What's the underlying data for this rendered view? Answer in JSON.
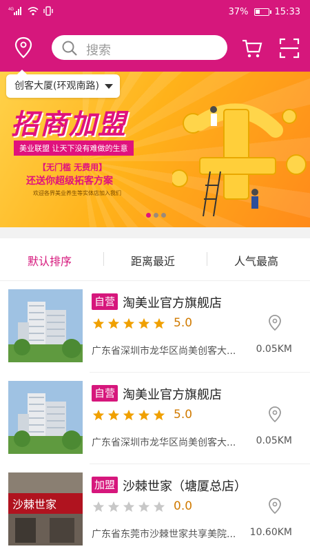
{
  "status_bar": {
    "signal_label": "4G",
    "battery": "37%",
    "battery_level": 0.37,
    "time": "15:33"
  },
  "header": {
    "search_placeholder": "搜索",
    "icons": [
      "location-icon",
      "search-icon",
      "cart-icon",
      "scan-icon"
    ]
  },
  "location_tip": "创客大厦(环观南路)",
  "banner": {
    "title": "招商加盟",
    "tag": "美业联盟  让天下没有难做的生意",
    "sub1": "【无门槛 无费用】",
    "sub2": "还送你超级拓客方案",
    "sub3": "欢迎各界美业养生等实体店加入我们",
    "page_count": 3,
    "active_index": 0
  },
  "sort_tabs": [
    {
      "label": "默认排序",
      "active": true
    },
    {
      "label": "距离最近",
      "active": false
    },
    {
      "label": "人气最高",
      "active": false
    }
  ],
  "stores": [
    {
      "badge": "自营",
      "name": "淘美业官方旗舰店",
      "stars": 5,
      "rating": "5.0",
      "address": "广东省深圳市龙华区尚美创客大...",
      "distance": "0.05KM"
    },
    {
      "badge": "自营",
      "name": "淘美业官方旗舰店",
      "stars": 5,
      "rating": "5.0",
      "address": "广东省深圳市龙华区尚美创客大...",
      "distance": "0.05KM"
    },
    {
      "badge": "加盟",
      "name": "沙棘世家（塘厦总店）",
      "stars": 0,
      "rating": "0.0",
      "address": "广东省东莞市沙棘世家共享美院...",
      "distance": "10.60KM"
    }
  ],
  "colors": {
    "brand": "#d6177c",
    "star_on": "#f0a000",
    "star_off": "#c8c8c8",
    "rating": "#d07a00"
  }
}
